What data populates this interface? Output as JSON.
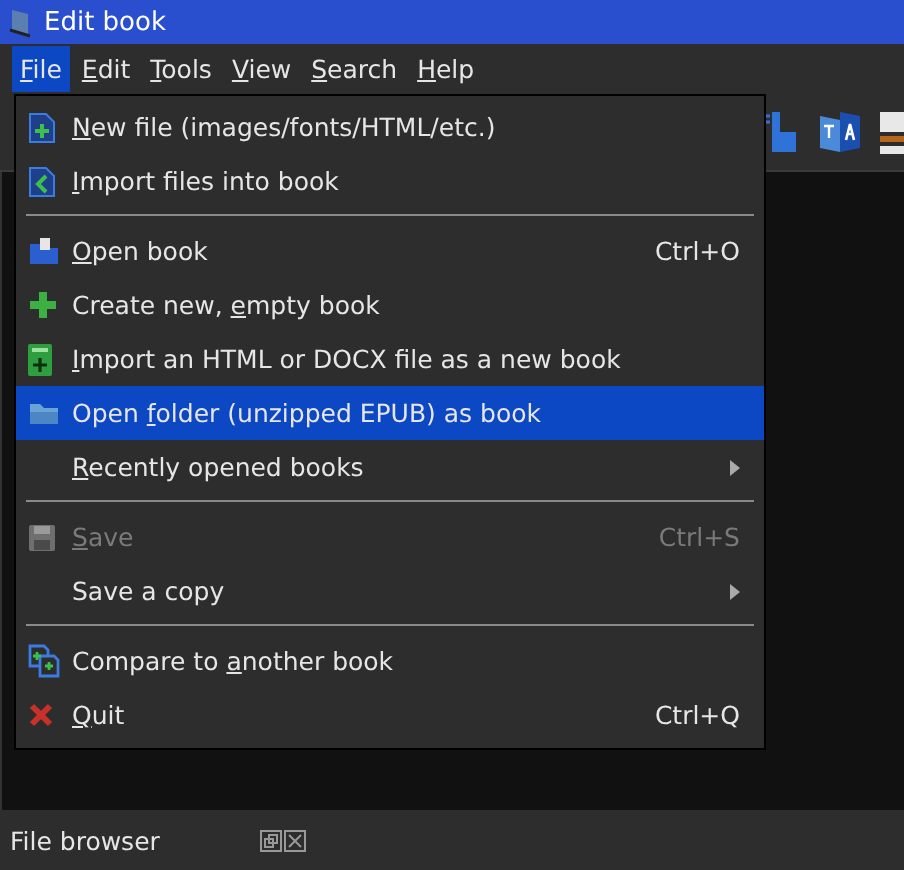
{
  "window": {
    "title": "Edit book"
  },
  "menubar": [
    {
      "key": "F",
      "post": "ile",
      "selected": true
    },
    {
      "key": "E",
      "post": "dit",
      "selected": false
    },
    {
      "key": "T",
      "post": "ools",
      "selected": false
    },
    {
      "key": "V",
      "post": "iew",
      "selected": false
    },
    {
      "key": "S",
      "post": "earch",
      "selected": false
    },
    {
      "key": "H",
      "post": "elp",
      "selected": false
    }
  ],
  "file_menu": [
    {
      "kind": "item",
      "key": "N",
      "post": "ew file (images/fonts/HTML/etc.)",
      "selected": false,
      "disabled": false
    },
    {
      "kind": "item",
      "key": "I",
      "post": "mport files into book",
      "selected": false,
      "disabled": false
    },
    {
      "kind": "separator"
    },
    {
      "kind": "item",
      "key": "O",
      "post": "pen book",
      "shortcut": "Ctrl+O",
      "selected": false,
      "disabled": false
    },
    {
      "kind": "item",
      "pre": "Create new, ",
      "key": "e",
      "post": "mpty book",
      "selected": false,
      "disabled": false
    },
    {
      "kind": "item",
      "key": "I",
      "post": "mport an HTML or DOCX file as a new book",
      "selected": false,
      "disabled": false
    },
    {
      "kind": "item",
      "pre": "Open ",
      "key": "f",
      "post": "older (unzipped EPUB) as book",
      "selected": true,
      "disabled": false
    },
    {
      "kind": "submenu",
      "key": "R",
      "post": "ecently opened books",
      "selected": false,
      "disabled": false
    },
    {
      "kind": "separator"
    },
    {
      "kind": "item",
      "key": "S",
      "post": "ave",
      "shortcut": "Ctrl+S",
      "selected": false,
      "disabled": true
    },
    {
      "kind": "submenu",
      "pre": "Save a copy",
      "selected": false,
      "disabled": false
    },
    {
      "kind": "separator"
    },
    {
      "kind": "item",
      "pre": "Compare to ",
      "key": "a",
      "post": "nother book",
      "selected": false,
      "disabled": false
    },
    {
      "kind": "item",
      "key": "Q",
      "post": "uit",
      "shortcut": "Ctrl+Q",
      "selected": false,
      "disabled": false
    }
  ],
  "dock": {
    "title": "File browser"
  }
}
